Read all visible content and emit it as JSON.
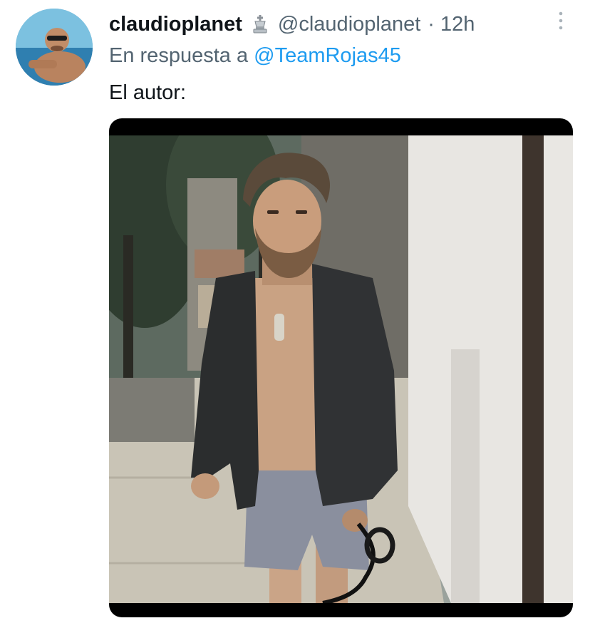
{
  "tweet": {
    "display_name": "claudioplanet",
    "badge_icon": "chess-king-icon",
    "handle": "@claudioplanet",
    "separator": "·",
    "timestamp": "12h",
    "reply_prefix": "En respuesta a",
    "reply_to": "@TeamRojas45",
    "text": "El autor:",
    "more_icon": "more-vertical-icon"
  },
  "colors": {
    "primary_text": "#0f1419",
    "secondary_text": "#536471",
    "link": "#1d9bf0",
    "background": "#ffffff"
  }
}
